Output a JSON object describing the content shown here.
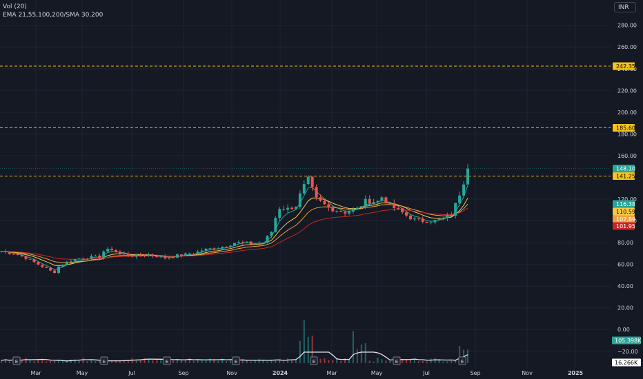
{
  "legend": {
    "line1": "Vol (20)",
    "line2": "EMA 21,55,100,200/SMA 30,200"
  },
  "currency_button": "INR",
  "colors": {
    "background": "#151924",
    "grid": "#1f2430",
    "axis_text": "#d1d4dc",
    "up": "#26a69a",
    "down": "#ef5350",
    "level_line": "#f5c31a",
    "ema_fast": "#26a69a",
    "ema_mid": "#f7c948",
    "ema_slow": "#f0a040",
    "ma_long": "#c62828",
    "volume_ma": "#e0e3eb"
  },
  "chart_data": {
    "type": "candlestick",
    "price_axis": {
      "ticks": [
        280,
        260,
        240,
        220,
        200,
        180,
        160,
        120,
        100,
        80,
        60,
        40,
        20,
        0,
        -20
      ],
      "tick_labels": [
        "280.00",
        "260.00",
        "240.00",
        "220.00",
        "200.00",
        "180.00",
        "160.00",
        "120.00",
        "100.00",
        "80.00",
        "60.00",
        "40.00",
        "20.00",
        "0.00",
        "−20.00"
      ],
      "range": [
        -30,
        293
      ]
    },
    "time_axis": {
      "labels": [
        "Mar",
        "May",
        "Jul",
        "Sep",
        "Nov",
        "2024",
        "Mar",
        "May",
        "Jul",
        "Sep",
        "Nov",
        "2025"
      ],
      "bold": [
        "2024",
        "2025"
      ]
    },
    "horizontal_levels": [
      {
        "value": 242.35,
        "label": "242.35"
      },
      {
        "value": 185.6,
        "label": "185.60"
      },
      {
        "value": 141.25,
        "label": "141.25"
      }
    ],
    "last_price": {
      "value": 148.1,
      "label": "148.10"
    },
    "ma_labels": [
      {
        "value": 116.38,
        "label": "116.38",
        "color": "#26a69a"
      },
      {
        "value": 110.59,
        "label": "110.59",
        "color": "#f7c948"
      },
      {
        "value": 107.89,
        "label": "107.89",
        "color": "#f0a040"
      },
      {
        "value": 101.95,
        "label": "101.95",
        "color": "#c62828"
      }
    ],
    "volume_labels": [
      {
        "label": "105.398K",
        "color": "#26a69a"
      },
      {
        "label": "16.266K",
        "color": "#ffffff"
      }
    ],
    "earnings_markers": [
      "E",
      "E",
      "E",
      "E",
      "E",
      "E",
      "E",
      "E"
    ],
    "price_path": [
      [
        0,
        72
      ],
      [
        3,
        70
      ],
      [
        6,
        66
      ],
      [
        9,
        60
      ],
      [
        12,
        54
      ],
      [
        13,
        53
      ],
      [
        14,
        58
      ],
      [
        17,
        64
      ],
      [
        20,
        66
      ],
      [
        24,
        67
      ],
      [
        25,
        72
      ],
      [
        27,
        74
      ],
      [
        29,
        70
      ],
      [
        32,
        68
      ],
      [
        36,
        69
      ],
      [
        40,
        66
      ],
      [
        43,
        68
      ],
      [
        47,
        70
      ],
      [
        49,
        73
      ],
      [
        52,
        75
      ],
      [
        55,
        77
      ],
      [
        57,
        80
      ],
      [
        59,
        80
      ],
      [
        61,
        79
      ],
      [
        64,
        80
      ],
      [
        66,
        90
      ],
      [
        67,
        103
      ],
      [
        68,
        112
      ],
      [
        70,
        111
      ],
      [
        72,
        114
      ],
      [
        73,
        124
      ],
      [
        74,
        132
      ],
      [
        75,
        138
      ],
      [
        77,
        120
      ],
      [
        80,
        112
      ],
      [
        84,
        108
      ],
      [
        87,
        111
      ],
      [
        89,
        118
      ],
      [
        92,
        118
      ],
      [
        93,
        122
      ],
      [
        95,
        114
      ],
      [
        97,
        110
      ],
      [
        99,
        105
      ],
      [
        101,
        101
      ],
      [
        103,
        100
      ],
      [
        106,
        100
      ],
      [
        108,
        102
      ],
      [
        109,
        104
      ],
      [
        110,
        106
      ],
      [
        111,
        115
      ],
      [
        112,
        125
      ],
      [
        113,
        136
      ],
      [
        114,
        148
      ]
    ]
  }
}
